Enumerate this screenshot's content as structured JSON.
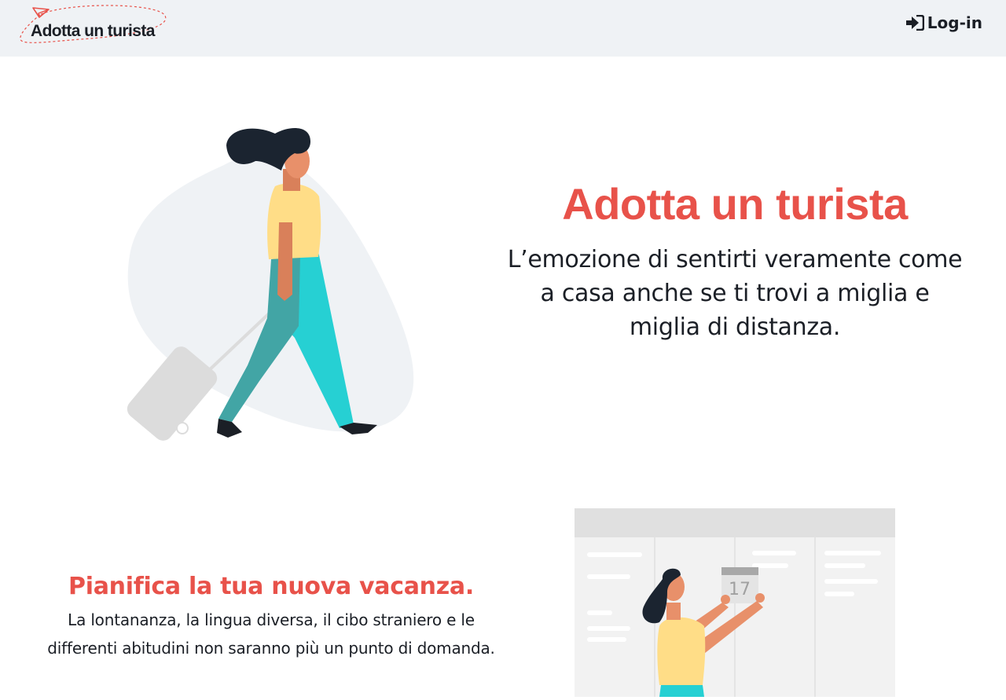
{
  "navbar": {
    "brand": "Adotta un turista",
    "login_label": "Log-in"
  },
  "hero": {
    "title": "Adotta un turista",
    "subtitle": "L’emozione di sentirti veramente come a casa anche se ti trovi a miglia e miglia di distanza."
  },
  "feature": {
    "title": "Pianifica la tua nuova vacanza.",
    "description": "La lontananza, la lingua diversa, il cibo straniero e le differenti abitudini non saranno più un punto di domanda.",
    "calendar_day": "17"
  },
  "colors": {
    "accent": "#e8524a",
    "navbar_bg": "#eff2f5",
    "text": "#1b1f26"
  }
}
